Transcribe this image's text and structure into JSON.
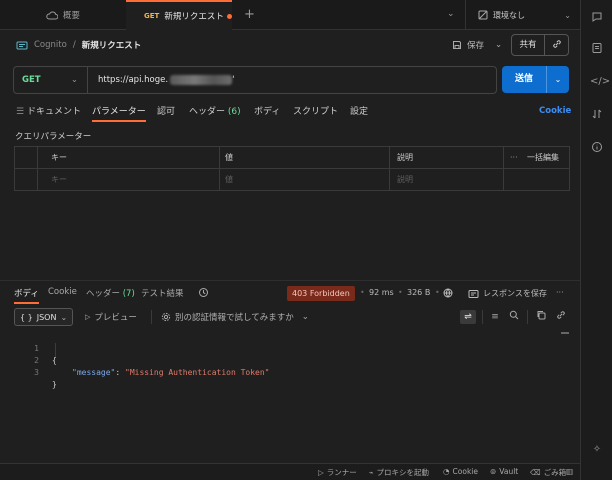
{
  "tabs": {
    "overview_label": "概要",
    "active_method": "GET",
    "active_label": "新規リクエスト",
    "environment": "環境なし"
  },
  "breadcrumb": {
    "collection": "Cognito",
    "separator": "/",
    "request": "新規リクエスト"
  },
  "header_actions": {
    "save_label": "保存",
    "share_label": "共有"
  },
  "request": {
    "method": "GET",
    "url": "https://api.hoge.",
    "url_suffix": "'",
    "send_label": "送信"
  },
  "request_tabs": [
    {
      "label": "ドキュメント"
    },
    {
      "label": "パラメーター"
    },
    {
      "label": "認可"
    },
    {
      "label": "ヘッダー",
      "count": "(6)"
    },
    {
      "label": "ボディ"
    },
    {
      "label": "スクリプト"
    },
    {
      "label": "設定"
    }
  ],
  "cookie_link": "Cookie",
  "query_params": {
    "title": "クエリパラメーター",
    "headers": {
      "key": "キー",
      "value": "値",
      "description": "説明",
      "bulk_edit": "一括編集"
    },
    "placeholders": {
      "key": "キー",
      "value": "値",
      "description": "説明"
    }
  },
  "response_tabs": [
    {
      "label": "ボディ"
    },
    {
      "label": "Cookie"
    },
    {
      "label": "ヘッダー",
      "count": "(7)"
    },
    {
      "label": "テスト結果"
    }
  ],
  "response_meta": {
    "status": "403 Forbidden",
    "time": "92 ms",
    "size": "326 B",
    "save_response": "レスポンスを保存"
  },
  "response_toolbar": {
    "format": "JSON",
    "preview": "プレビュー",
    "auth_try": "別の認証情報で試してみますか"
  },
  "response_body": {
    "lines": [
      {
        "n": "1",
        "text": "{"
      },
      {
        "n": "2",
        "key": "\"message\"",
        "colon": ": ",
        "value": "\"Missing Authentication Token\""
      },
      {
        "n": "3",
        "text": "}"
      }
    ]
  },
  "status_bar": {
    "runner": "ランナー",
    "proxy": "プロキシを起動",
    "cookie": "Cookie",
    "vault": "Vault",
    "trash": "ごみ箱"
  },
  "colors": {
    "accent": "#ff6c37",
    "send": "#0d6ecf",
    "method_get": "#6bdd9a",
    "error_badge": "#7a2a1a"
  }
}
